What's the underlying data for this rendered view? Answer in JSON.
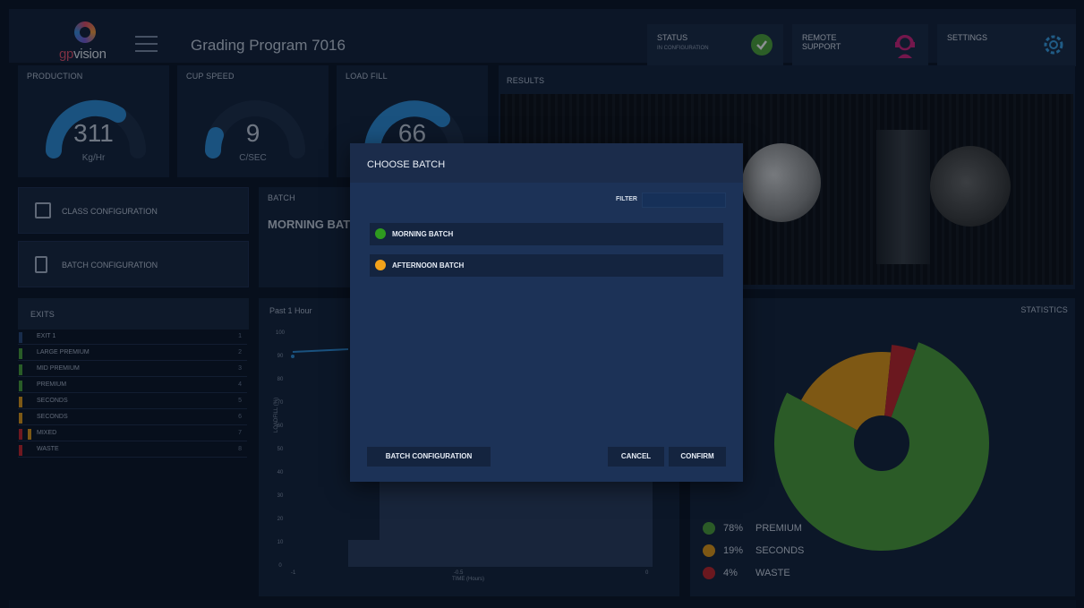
{
  "header": {
    "logo_prefix": "gp",
    "logo_suffix": "vision",
    "title": "Grading Program 7016",
    "status_label": "STATUS",
    "status_sub": "IN CONFIGURATION",
    "remote_label_1": "REMOTE",
    "remote_label_2": "SUPPORT",
    "settings_label": "SETTINGS"
  },
  "gauges": [
    {
      "label": "PRODUCTION",
      "value": "311",
      "unit": "Kg/Hr",
      "level": 0.78
    },
    {
      "label": "CUP SPEED",
      "value": "9",
      "unit": "C/SEC",
      "level": 0.15
    },
    {
      "label": "LOAD FILL",
      "value": "66",
      "unit": "",
      "level": 0.66
    }
  ],
  "left_nav": {
    "class_config": "CLASS CONFIGURATION",
    "batch_config": "BATCH CONFIGURATION"
  },
  "batch_panel": {
    "label": "BATCH",
    "value": "MORNING BAT"
  },
  "results": {
    "label": "RESULTS"
  },
  "exits": {
    "title": "EXITS",
    "rows": [
      {
        "name": "Exit 1",
        "no": "1",
        "color": "#2a4a7a",
        "color2": ""
      },
      {
        "name": "LARGE PREMIUM",
        "no": "2",
        "color": "#4aa13a",
        "color2": ""
      },
      {
        "name": "MID PREMIUM",
        "no": "3",
        "color": "#4aa13a",
        "color2": ""
      },
      {
        "name": "PREMIUM",
        "no": "4",
        "color": "#4aa13a",
        "color2": ""
      },
      {
        "name": "SECONDS",
        "no": "5",
        "color": "#e09a18",
        "color2": ""
      },
      {
        "name": "SECONDS",
        "no": "6",
        "color": "#e09a18",
        "color2": ""
      },
      {
        "name": "MIXED",
        "no": "7",
        "color": "#c9252c",
        "color2": "#e09a18"
      },
      {
        "name": "WASTE",
        "no": "8",
        "color": "#c9252c",
        "color2": ""
      }
    ]
  },
  "load_chart": {
    "title": "Past 1 Hour",
    "ylabel": "LOADFILL (%)",
    "xlabel": "TIME (Hours)",
    "yticks": [
      "100",
      "90",
      "80",
      "70",
      "60",
      "50",
      "40",
      "30",
      "20",
      "10",
      "0"
    ],
    "xticks": [
      "-1",
      "-0.5",
      "0"
    ]
  },
  "statistics": {
    "label": "STATISTICS",
    "legend": [
      {
        "pct": "78%",
        "name": "PREMIUM",
        "color": "#4e9e3a"
      },
      {
        "pct": "19%",
        "name": "SECONDS",
        "color": "#e39a16"
      },
      {
        "pct": "4%",
        "name": "WASTE",
        "color": "#c1262b"
      }
    ]
  },
  "chart_data": {
    "type": "pie",
    "categories": [
      "PREMIUM",
      "SECONDS",
      "WASTE"
    ],
    "values": [
      78,
      19,
      4
    ],
    "title": "STATISTICS"
  },
  "modal": {
    "title": "CHOOSE BATCH",
    "filter_label": "FILTER",
    "filter_value": "",
    "batches": [
      {
        "name": "MORNING BATCH",
        "color": "#2e9a1f"
      },
      {
        "name": "AFTERNOON BATCH",
        "color": "#f2a21a"
      }
    ],
    "btn_batch_config": "BATCH CONFIGURATION",
    "btn_cancel": "CANCEL",
    "btn_confirm": "CONFIRM"
  }
}
